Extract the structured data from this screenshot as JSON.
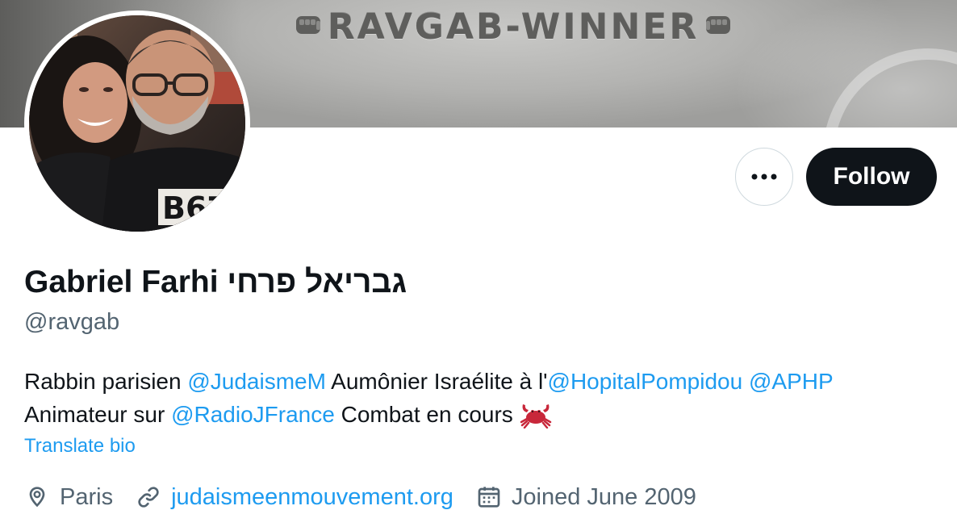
{
  "banner": {
    "text": "RAVGAB-WINNER",
    "left_icon": "fist-icon",
    "right_icon": "fist-icon"
  },
  "avatar": {
    "icon": "profile-photo"
  },
  "actions": {
    "more_icon": "more-horizontal-icon",
    "follow_label": "Follow"
  },
  "profile": {
    "display_name": "Gabriel Farhi גבריאל פרחי",
    "handle": "@ravgab"
  },
  "bio": {
    "part1": "Rabbin parisien ",
    "mention1": "@JudaismeM",
    "part2": " Aumônier Israélite à l'",
    "mention2": "@HopitalPompidou",
    "part3": " ",
    "mention3": "@APHP",
    "part4": "Animateur sur ",
    "mention4": "@RadioJFrance",
    "part5": " Combat en cours ",
    "emoji": "crab-icon"
  },
  "translate_label": "Translate bio",
  "meta": {
    "location": "Paris",
    "location_icon": "location-pin-icon",
    "website": "judaismeenmouvement.org",
    "website_icon": "link-icon",
    "joined": "Joined June 2009",
    "joined_icon": "calendar-icon"
  },
  "colors": {
    "accent": "#1d9bf0",
    "text_primary": "#0f1419",
    "text_secondary": "#536471",
    "follow_bg": "#0f1419"
  }
}
